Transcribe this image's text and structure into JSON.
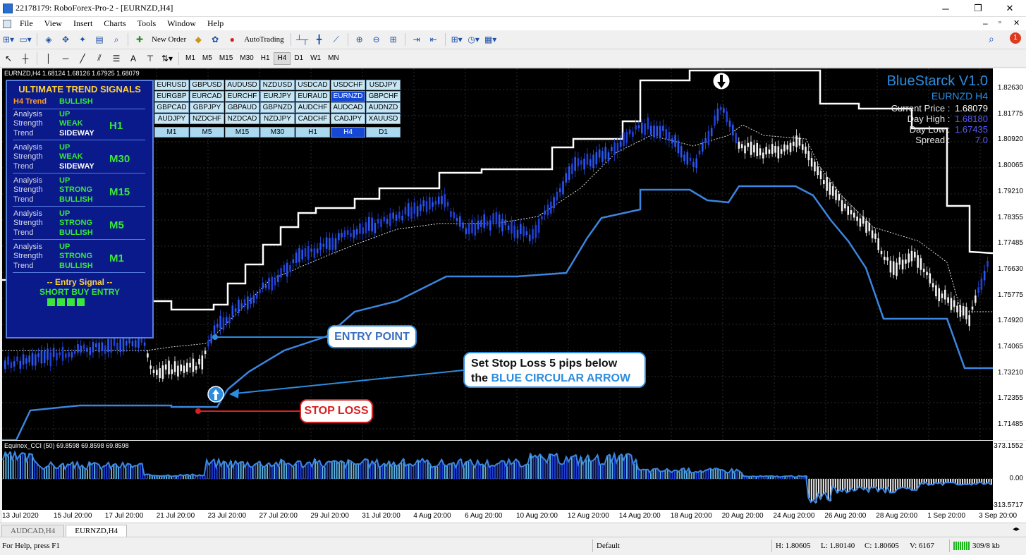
{
  "window": {
    "title": "22178179: RoboForex-Pro-2 - [EURNZD,H4]",
    "minimize": "─",
    "restore": "❐",
    "close": "✕"
  },
  "menu": {
    "items": [
      "File",
      "View",
      "Insert",
      "Charts",
      "Tools",
      "Window",
      "Help"
    ]
  },
  "toolbar1": {
    "new_order": "New Order",
    "autotrading": "AutoTrading"
  },
  "toolbar2": {
    "timeframes": [
      "M1",
      "M5",
      "M15",
      "M30",
      "H1",
      "H4",
      "D1",
      "W1",
      "MN"
    ],
    "active_timeframe": "H4"
  },
  "chart": {
    "header": "EURNZD,H4  1.68124 1.68126 1.67925 1.68079",
    "price_labels": [
      "1.82630",
      "1.81775",
      "1.80920",
      "1.80065",
      "1.79210",
      "1.78355",
      "1.77485",
      "1.76630",
      "1.75775",
      "1.74920",
      "1.74065",
      "1.73210",
      "1.72355",
      "1.71485"
    ],
    "indicator_header": "Equinox_CCI (50) 69.8598 69.8598 69.8598",
    "indicator_labels": [
      "373.1552",
      "0.00",
      "-313.5717"
    ],
    "date_labels": [
      "13 Jul 2020",
      "15 Jul 20:00",
      "17 Jul 20:00",
      "21 Jul 20:00",
      "23 Jul 20:00",
      "27 Jul 20:00",
      "29 Jul 20:00",
      "31 Jul 20:00",
      "4 Aug 20:00",
      "6 Aug 20:00",
      "10 Aug 20:00",
      "12 Aug 20:00",
      "14 Aug 20:00",
      "18 Aug 20:00",
      "20 Aug 20:00",
      "24 Aug 20:00",
      "26 Aug 20:00",
      "28 Aug 20:00",
      "1 Sep 20:00",
      "3 Sep 20:00"
    ]
  },
  "signals": {
    "title": "ULTIMATE TREND SIGNALS",
    "h4_label": "H4 Trend",
    "h4_value": "BULLISH",
    "blocks": [
      {
        "tf": "H1",
        "analysis": "UP",
        "strength": "WEAK",
        "trend": "SIDEWAY"
      },
      {
        "tf": "M30",
        "analysis": "UP",
        "strength": "WEAK",
        "trend": "SIDEWAY"
      },
      {
        "tf": "M15",
        "analysis": "UP",
        "strength": "STRONG",
        "trend": "BULLISH"
      },
      {
        "tf": "M5",
        "analysis": "UP",
        "strength": "STRONG",
        "trend": "BULLISH"
      },
      {
        "tf": "M1",
        "analysis": "UP",
        "strength": "STRONG",
        "trend": "BULLISH"
      }
    ],
    "analysis_label": "Analysis",
    "strength_label": "Strength",
    "trend_label": "Trend",
    "entry_title": "-- Entry Signal --",
    "entry_value": "SHORT BUY ENTRY"
  },
  "symbols": {
    "rows": [
      [
        "EURUSD",
        "GBPUSD",
        "AUDUSD",
        "NZDUSD",
        "USDCAD",
        "USDCHF",
        "USDJPY"
      ],
      [
        "EURGBP",
        "EURCAD",
        "EURCHF",
        "EURJPY",
        "EURAUD",
        "EURNZD",
        "GBPCHF"
      ],
      [
        "GBPCAD",
        "GBPJPY",
        "GBPAUD",
        "GBPNZD",
        "AUDCHF",
        "AUDCAD",
        "AUDNZD"
      ],
      [
        "AUDJPY",
        "NZDCHF",
        "NZDCAD",
        "NZDJPY",
        "CADCHF",
        "CADJPY",
        "XAUUSD"
      ]
    ],
    "selected": "EURNZD",
    "timeframes": [
      "M1",
      "M5",
      "M15",
      "M30",
      "H1",
      "H4",
      "D1"
    ],
    "selected_tf": "H4"
  },
  "info": {
    "title": "BlueStarck V1.0",
    "subtitle": "EURNZD H4",
    "current_price_label": "Current Price :",
    "current_price": "1.68079",
    "day_high_label": "Day High :",
    "day_high": "1.68180",
    "day_low_label": "Day Low :",
    "day_low": "1.67435",
    "spread_label": "Spread :",
    "spread": "7.0"
  },
  "callouts": {
    "entry": "ENTRY POINT",
    "stoploss_line1": "Set Stop Loss 5 pips below",
    "stoploss_line2_a": "the ",
    "stoploss_line2_b": "BLUE CIRCULAR ARROW",
    "stop": "STOP LOSS"
  },
  "tabs": [
    "AUDCAD,H4",
    "EURNZD,H4"
  ],
  "active_tab": "EURNZD,H4",
  "status": {
    "help": "For Help, press F1",
    "profile": "Default",
    "high": "H: 1.80605",
    "low": "L: 1.80140",
    "close": "C: 1.80605",
    "volume": "V: 6167",
    "traffic": "309/8 kb"
  },
  "colors": {
    "accent_blue": "#2c8cdf",
    "signal_green": "#39e63a",
    "signal_yellow": "#ffd23a",
    "stop_red": "#d62020"
  }
}
